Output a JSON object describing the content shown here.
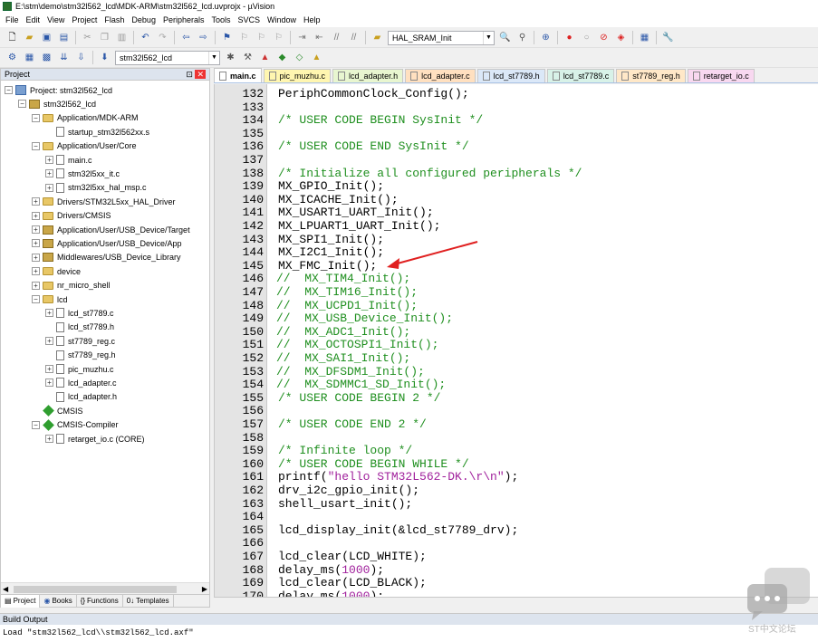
{
  "window": {
    "title": "E:\\stm\\demo\\stm32l562_lcd\\MDK-ARM\\stm32l562_lcd.uvprojx - µVision"
  },
  "menu": [
    "File",
    "Edit",
    "View",
    "Project",
    "Flash",
    "Debug",
    "Peripherals",
    "Tools",
    "SVCS",
    "Window",
    "Help"
  ],
  "toolbar": {
    "target_combo": "HAL_SRAM_Init",
    "project_combo": "stm32l562_lcd"
  },
  "project_panel": {
    "title": "Project",
    "tree": [
      {
        "label": "Project: stm32l562_lcd",
        "level": 0,
        "icon": "project",
        "exp": "-"
      },
      {
        "label": "stm32l562_lcd",
        "level": 1,
        "icon": "target",
        "exp": "-"
      },
      {
        "label": "Application/MDK-ARM",
        "level": 2,
        "icon": "folder",
        "exp": "-"
      },
      {
        "label": "startup_stm32l562xx.s",
        "level": 3,
        "icon": "file",
        "exp": ""
      },
      {
        "label": "Application/User/Core",
        "level": 2,
        "icon": "folder",
        "exp": "-"
      },
      {
        "label": "main.c",
        "level": 3,
        "icon": "file",
        "exp": "+"
      },
      {
        "label": "stm32l5xx_it.c",
        "level": 3,
        "icon": "file",
        "exp": "+"
      },
      {
        "label": "stm32l5xx_hal_msp.c",
        "level": 3,
        "icon": "file",
        "exp": "+"
      },
      {
        "label": "Drivers/STM32L5xx_HAL_Driver",
        "level": 2,
        "icon": "folder",
        "exp": "+"
      },
      {
        "label": "Drivers/CMSIS",
        "level": 2,
        "icon": "folder",
        "exp": "+"
      },
      {
        "label": "Application/User/USB_Device/Target",
        "level": 2,
        "icon": "group",
        "exp": "+"
      },
      {
        "label": "Application/User/USB_Device/App",
        "level": 2,
        "icon": "group",
        "exp": "+"
      },
      {
        "label": "Middlewares/USB_Device_Library",
        "level": 2,
        "icon": "group",
        "exp": "+"
      },
      {
        "label": "device",
        "level": 2,
        "icon": "folder",
        "exp": "+"
      },
      {
        "label": "nr_micro_shell",
        "level": 2,
        "icon": "folder",
        "exp": "+"
      },
      {
        "label": "lcd",
        "level": 2,
        "icon": "folder",
        "exp": "-"
      },
      {
        "label": "lcd_st7789.c",
        "level": 3,
        "icon": "file",
        "exp": "+"
      },
      {
        "label": "lcd_st7789.h",
        "level": 3,
        "icon": "file",
        "exp": ""
      },
      {
        "label": "st7789_reg.c",
        "level": 3,
        "icon": "file",
        "exp": "+"
      },
      {
        "label": "st7789_reg.h",
        "level": 3,
        "icon": "file",
        "exp": ""
      },
      {
        "label": "pic_muzhu.c",
        "level": 3,
        "icon": "file",
        "exp": "+"
      },
      {
        "label": "lcd_adapter.c",
        "level": 3,
        "icon": "file",
        "exp": "+"
      },
      {
        "label": "lcd_adapter.h",
        "level": 3,
        "icon": "file",
        "exp": ""
      },
      {
        "label": "CMSIS",
        "level": 2,
        "icon": "diamond",
        "exp": ""
      },
      {
        "label": "CMSIS-Compiler",
        "level": 2,
        "icon": "diamond",
        "exp": "-"
      },
      {
        "label": "retarget_io.c (CORE)",
        "level": 3,
        "icon": "file",
        "exp": "+"
      }
    ],
    "tabs": [
      "Project",
      "Books",
      "Functions",
      "Templates"
    ]
  },
  "editor_tabs": [
    {
      "label": "main.c",
      "color": "#ffffff",
      "active": true
    },
    {
      "label": "pic_muzhu.c",
      "color": "#fff6b0",
      "active": false
    },
    {
      "label": "lcd_adapter.h",
      "color": "#e8f6d0",
      "active": false
    },
    {
      "label": "lcd_adapter.c",
      "color": "#ffe0c0",
      "active": false
    },
    {
      "label": "lcd_st7789.h",
      "color": "#dbe8f8",
      "active": false
    },
    {
      "label": "lcd_st7789.c",
      "color": "#d8f2e8",
      "active": false
    },
    {
      "label": "st7789_reg.h",
      "color": "#ffe8c8",
      "active": false
    },
    {
      "label": "retarget_io.c",
      "color": "#f8d8f0",
      "active": false
    }
  ],
  "code": [
    {
      "n": "132",
      "t": "PeriphCommonClock_Config();",
      "k": "plain"
    },
    {
      "n": "133",
      "t": "",
      "k": "plain"
    },
    {
      "n": "134",
      "t": "/* USER CODE BEGIN SysInit */",
      "k": "cm"
    },
    {
      "n": "135",
      "t": "",
      "k": "plain"
    },
    {
      "n": "136",
      "t": "/* USER CODE END SysInit */",
      "k": "cm"
    },
    {
      "n": "137",
      "t": "",
      "k": "plain"
    },
    {
      "n": "138",
      "t": "/* Initialize all configured peripherals */",
      "k": "cm"
    },
    {
      "n": "139",
      "t": "MX_GPIO_Init();",
      "k": "plain"
    },
    {
      "n": "140",
      "t": "MX_ICACHE_Init();",
      "k": "plain"
    },
    {
      "n": "141",
      "t": "MX_USART1_UART_Init();",
      "k": "plain"
    },
    {
      "n": "142",
      "t": "MX_LPUART1_UART_Init();",
      "k": "plain"
    },
    {
      "n": "143",
      "t": "MX_SPI1_Init();",
      "k": "plain"
    },
    {
      "n": "144",
      "t": "MX_I2C1_Init();",
      "k": "plain"
    },
    {
      "n": "145",
      "t": "MX_FMC_Init();",
      "k": "plain"
    },
    {
      "n": "146",
      "t": "//  MX_TIM4_Init();",
      "k": "slash"
    },
    {
      "n": "147",
      "t": "//  MX_TIM16_Init();",
      "k": "slash"
    },
    {
      "n": "148",
      "t": "//  MX_UCPD1_Init();",
      "k": "slash"
    },
    {
      "n": "149",
      "t": "//  MX_USB_Device_Init();",
      "k": "slash"
    },
    {
      "n": "150",
      "t": "//  MX_ADC1_Init();",
      "k": "slash"
    },
    {
      "n": "151",
      "t": "//  MX_OCTOSPI1_Init();",
      "k": "slash"
    },
    {
      "n": "152",
      "t": "//  MX_SAI1_Init();",
      "k": "slash"
    },
    {
      "n": "153",
      "t": "//  MX_DFSDM1_Init();",
      "k": "slash"
    },
    {
      "n": "154",
      "t": "//  MX_SDMMC1_SD_Init();",
      "k": "slash"
    },
    {
      "n": "155",
      "t": "/* USER CODE BEGIN 2 */",
      "k": "cm"
    },
    {
      "n": "156",
      "t": "",
      "k": "plain"
    },
    {
      "n": "157",
      "t": "/* USER CODE END 2 */",
      "k": "cm"
    },
    {
      "n": "158",
      "t": "",
      "k": "plain"
    },
    {
      "n": "159",
      "t": "/* Infinite loop */",
      "k": "cm"
    },
    {
      "n": "160",
      "t": "/* USER CODE BEGIN WHILE */",
      "k": "cm"
    },
    {
      "n": "161",
      "t": "printf(\"hello STM32L562-DK.\\r\\n\");",
      "k": "printf"
    },
    {
      "n": "162",
      "t": "drv_i2c_gpio_init();",
      "k": "plain"
    },
    {
      "n": "163",
      "t": "shell_usart_init();",
      "k": "plain"
    },
    {
      "n": "164",
      "t": "",
      "k": "plain"
    },
    {
      "n": "165",
      "t": "lcd_display_init(&lcd_st7789_drv);",
      "k": "plain"
    },
    {
      "n": "166",
      "t": "",
      "k": "plain"
    },
    {
      "n": "167",
      "t": "lcd_clear(LCD_WHITE);",
      "k": "plain"
    },
    {
      "n": "168",
      "t": "delay_ms(1000);",
      "k": "delay"
    },
    {
      "n": "169",
      "t": "lcd_clear(LCD_BLACK);",
      "k": "plain"
    },
    {
      "n": "170",
      "t": "delay_ms(1000);",
      "k": "delay"
    }
  ],
  "build_output": {
    "title": "Build Output",
    "text": "Load \"stm32l562_lcd\\\\stm32l562_lcd.axf\""
  },
  "watermark": {
    "text": "ST中文论坛"
  }
}
